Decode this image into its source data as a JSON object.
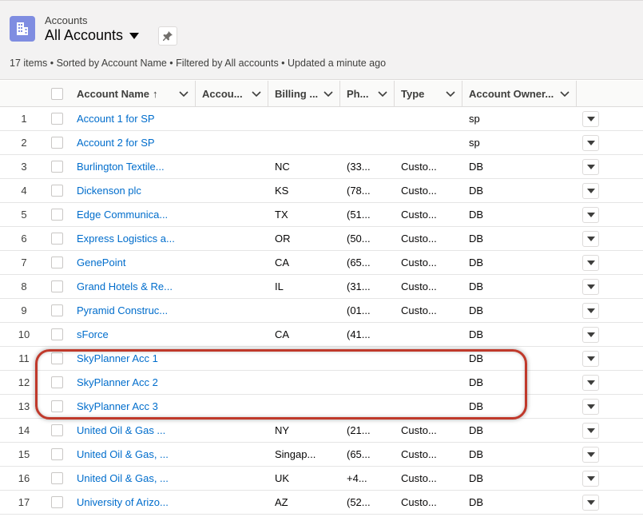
{
  "header": {
    "object_label": "Accounts",
    "list_title": "All Accounts",
    "summary": "17 items • Sorted by Account Name • Filtered by All accounts • Updated a minute ago"
  },
  "icons": {
    "object": "accounts-grid-icon",
    "pin": "pin-icon",
    "sort": "arrow-up-icon",
    "chevron": "chevron-down-icon",
    "row_action": "triangle-down-icon"
  },
  "colors": {
    "link": "#006dcc",
    "object_icon": "#7f8de1",
    "highlight": "#c0392b"
  },
  "columns": [
    {
      "label": "Account Name",
      "sort_indicator": "↑"
    },
    {
      "label": "Accou..."
    },
    {
      "label": "Billing ..."
    },
    {
      "label": "Ph..."
    },
    {
      "label": "Type"
    },
    {
      "label": "Account Owner..."
    }
  ],
  "rows": [
    {
      "num": "1",
      "name": "Account 1 for SP",
      "state": "",
      "phone": "",
      "type": "",
      "owner": "sp"
    },
    {
      "num": "2",
      "name": "Account 2 for SP",
      "state": "",
      "phone": "",
      "type": "",
      "owner": "sp"
    },
    {
      "num": "3",
      "name": "Burlington Textile...",
      "state": "NC",
      "phone": "(33...",
      "type": "Custo...",
      "owner": "DB"
    },
    {
      "num": "4",
      "name": "Dickenson plc",
      "state": "KS",
      "phone": "(78...",
      "type": "Custo...",
      "owner": "DB"
    },
    {
      "num": "5",
      "name": "Edge Communica...",
      "state": "TX",
      "phone": "(51...",
      "type": "Custo...",
      "owner": "DB"
    },
    {
      "num": "6",
      "name": "Express Logistics a...",
      "state": "OR",
      "phone": "(50...",
      "type": "Custo...",
      "owner": "DB"
    },
    {
      "num": "7",
      "name": "GenePoint",
      "state": "CA",
      "phone": "(65...",
      "type": "Custo...",
      "owner": "DB"
    },
    {
      "num": "8",
      "name": "Grand Hotels & Re...",
      "state": "IL",
      "phone": "(31...",
      "type": "Custo...",
      "owner": "DB"
    },
    {
      "num": "9",
      "name": "Pyramid Construc...",
      "state": "",
      "phone": "(01...",
      "type": "Custo...",
      "owner": "DB"
    },
    {
      "num": "10",
      "name": "sForce",
      "state": "CA",
      "phone": "(41...",
      "type": "",
      "owner": "DB"
    },
    {
      "num": "11",
      "name": "SkyPlanner Acc 1",
      "state": "",
      "phone": "",
      "type": "",
      "owner": "DB"
    },
    {
      "num": "12",
      "name": "SkyPlanner Acc 2",
      "state": "",
      "phone": "",
      "type": "",
      "owner": "DB"
    },
    {
      "num": "13",
      "name": "SkyPlanner Acc 3",
      "state": "",
      "phone": "",
      "type": "",
      "owner": "DB"
    },
    {
      "num": "14",
      "name": "United Oil & Gas ...",
      "state": "NY",
      "phone": "(21...",
      "type": "Custo...",
      "owner": "DB"
    },
    {
      "num": "15",
      "name": "United Oil & Gas, ...",
      "state": "Singap...",
      "phone": "(65...",
      "type": "Custo...",
      "owner": "DB"
    },
    {
      "num": "16",
      "name": "United Oil & Gas, ...",
      "state": "UK",
      "phone": "+4...",
      "type": "Custo...",
      "owner": "DB"
    },
    {
      "num": "17",
      "name": "University of Arizo...",
      "state": "AZ",
      "phone": "(52...",
      "type": "Custo...",
      "owner": "DB"
    }
  ]
}
